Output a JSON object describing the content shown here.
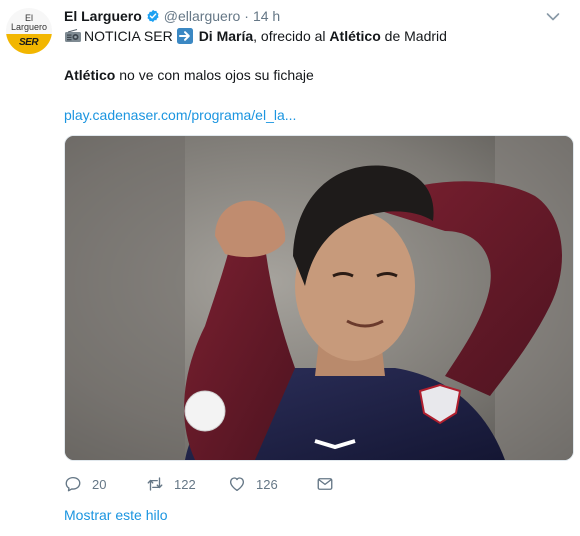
{
  "avatar": {
    "line1": "El",
    "line2": "Larguero",
    "brand": "SER"
  },
  "author": {
    "name": "El Larguero",
    "handle": "@ellarguero",
    "separator": "·",
    "time": "14 h"
  },
  "tweet": {
    "line1": {
      "prefix": "NOTICIA SER",
      "player": "Di María",
      "middle": ", ofrecido al ",
      "club": "Atlético",
      "suffix": " de Madrid"
    },
    "line2": {
      "club": "Atlético",
      "rest": " no ve con malos ojos su fichaje"
    },
    "link": "play.cadenaser.com/programa/el_la..."
  },
  "actions": {
    "replies": "20",
    "retweets": "122",
    "likes": "126"
  },
  "thread_link": "Mostrar este hilo",
  "colors": {
    "link": "#1b95e0",
    "muted": "#657786",
    "verified": "#1da1f2",
    "arrow_emoji": "#3b88c3"
  },
  "icons": [
    "verified-icon",
    "caret-down-icon",
    "radio-icon",
    "right-arrow-icon",
    "reply-icon",
    "retweet-icon",
    "like-icon",
    "message-icon"
  ]
}
